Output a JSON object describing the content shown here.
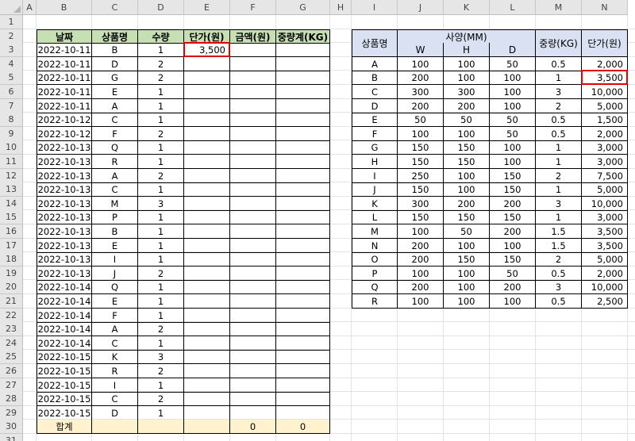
{
  "columns": [
    "A",
    "B",
    "C",
    "D",
    "E",
    "F",
    "G",
    "H",
    "I",
    "J",
    "K",
    "L",
    "M",
    "N"
  ],
  "rows": [
    "1",
    "2",
    "3",
    "4",
    "5",
    "6",
    "7",
    "8",
    "9",
    "10",
    "11",
    "12",
    "13",
    "14",
    "15",
    "16",
    "17",
    "18",
    "19",
    "20",
    "21",
    "22",
    "23",
    "24",
    "25",
    "26",
    "27",
    "28",
    "29",
    "30",
    "31"
  ],
  "left_table": {
    "headers": [
      "날짜",
      "상품명",
      "수량",
      "단가(원)",
      "금액(원)",
      "중량계(KG)"
    ],
    "rows": [
      [
        "2022-10-11",
        "B",
        "1",
        "3,500",
        "",
        ""
      ],
      [
        "2022-10-11",
        "D",
        "2",
        "",
        "",
        ""
      ],
      [
        "2022-10-11",
        "G",
        "2",
        "",
        "",
        ""
      ],
      [
        "2022-10-11",
        "E",
        "1",
        "",
        "",
        ""
      ],
      [
        "2022-10-11",
        "A",
        "1",
        "",
        "",
        ""
      ],
      [
        "2022-10-12",
        "C",
        "1",
        "",
        "",
        ""
      ],
      [
        "2022-10-12",
        "F",
        "2",
        "",
        "",
        ""
      ],
      [
        "2022-10-13",
        "Q",
        "1",
        "",
        "",
        ""
      ],
      [
        "2022-10-13",
        "R",
        "1",
        "",
        "",
        ""
      ],
      [
        "2022-10-13",
        "A",
        "2",
        "",
        "",
        ""
      ],
      [
        "2022-10-13",
        "C",
        "1",
        "",
        "",
        ""
      ],
      [
        "2022-10-13",
        "M",
        "3",
        "",
        "",
        ""
      ],
      [
        "2022-10-13",
        "P",
        "1",
        "",
        "",
        ""
      ],
      [
        "2022-10-13",
        "B",
        "1",
        "",
        "",
        ""
      ],
      [
        "2022-10-13",
        "E",
        "1",
        "",
        "",
        ""
      ],
      [
        "2022-10-13",
        "I",
        "1",
        "",
        "",
        ""
      ],
      [
        "2022-10-13",
        "J",
        "2",
        "",
        "",
        ""
      ],
      [
        "2022-10-14",
        "Q",
        "1",
        "",
        "",
        ""
      ],
      [
        "2022-10-14",
        "E",
        "1",
        "",
        "",
        ""
      ],
      [
        "2022-10-14",
        "F",
        "1",
        "",
        "",
        ""
      ],
      [
        "2022-10-14",
        "A",
        "2",
        "",
        "",
        ""
      ],
      [
        "2022-10-14",
        "C",
        "1",
        "",
        "",
        ""
      ],
      [
        "2022-10-15",
        "K",
        "3",
        "",
        "",
        ""
      ],
      [
        "2022-10-15",
        "R",
        "2",
        "",
        "",
        ""
      ],
      [
        "2022-10-15",
        "I",
        "1",
        "",
        "",
        ""
      ],
      [
        "2022-10-15",
        "C",
        "2",
        "",
        "",
        ""
      ],
      [
        "2022-10-15",
        "D",
        "1",
        "",
        "",
        ""
      ]
    ],
    "total_row": [
      "합계",
      "",
      "",
      "",
      "0",
      "0"
    ]
  },
  "right_table": {
    "header_product": "상품명",
    "header_spec": "사양(MM)",
    "header_weight": "중량(KG)",
    "header_price": "단가(원)",
    "sub_headers": [
      "W",
      "H",
      "D"
    ],
    "rows": [
      [
        "A",
        "100",
        "100",
        "50",
        "0.5",
        "2,000"
      ],
      [
        "B",
        "200",
        "100",
        "100",
        "1",
        "3,500"
      ],
      [
        "C",
        "300",
        "300",
        "100",
        "3",
        "10,000"
      ],
      [
        "D",
        "200",
        "200",
        "100",
        "2",
        "5,000"
      ],
      [
        "E",
        "50",
        "50",
        "50",
        "0.5",
        "1,500"
      ],
      [
        "F",
        "100",
        "100",
        "50",
        "0.5",
        "2,000"
      ],
      [
        "G",
        "150",
        "150",
        "100",
        "1",
        "3,000"
      ],
      [
        "H",
        "150",
        "150",
        "100",
        "1",
        "3,000"
      ],
      [
        "I",
        "250",
        "100",
        "150",
        "2",
        "7,500"
      ],
      [
        "J",
        "150",
        "100",
        "150",
        "1",
        "5,000"
      ],
      [
        "K",
        "300",
        "200",
        "200",
        "3",
        "10,000"
      ],
      [
        "L",
        "150",
        "150",
        "150",
        "1",
        "3,000"
      ],
      [
        "M",
        "100",
        "50",
        "200",
        "1.5",
        "3,500"
      ],
      [
        "N",
        "200",
        "100",
        "100",
        "1.5",
        "3,500"
      ],
      [
        "O",
        "200",
        "150",
        "150",
        "2",
        "5,000"
      ],
      [
        "P",
        "100",
        "100",
        "50",
        "0.5",
        "2,000"
      ],
      [
        "Q",
        "200",
        "100",
        "200",
        "3",
        "10,000"
      ],
      [
        "R",
        "100",
        "100",
        "100",
        "0.5",
        "2,500"
      ]
    ]
  },
  "colors": {
    "header_green": "#c6e0b4",
    "header_blue": "#d9e1f2",
    "total_yellow": "#fff2cc",
    "highlight_red": "#e00000"
  }
}
